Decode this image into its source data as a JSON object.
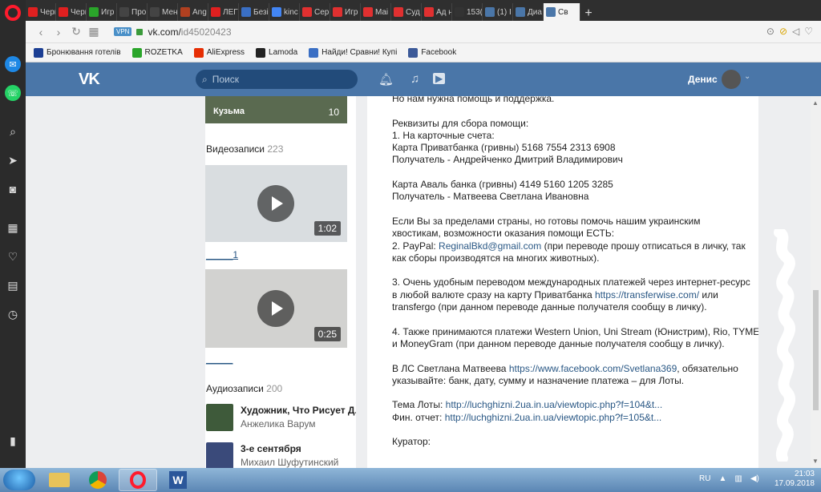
{
  "browser": {
    "tabs": [
      {
        "label": "Черг",
        "color": "#e02020"
      },
      {
        "label": "Черг",
        "color": "#e02020"
      },
      {
        "label": "Игр",
        "color": "#2aa52a"
      },
      {
        "label": "Про",
        "color": "#444444"
      },
      {
        "label": "Мен",
        "color": "#444444"
      },
      {
        "label": "Ang",
        "color": "#b04020"
      },
      {
        "label": "ЛЕГ",
        "color": "#e02020"
      },
      {
        "label": "Безі",
        "color": "#3a6fc4"
      },
      {
        "label": "kinc",
        "color": "#4285f4"
      },
      {
        "label": "Сер",
        "color": "#e03030"
      },
      {
        "label": "Игр",
        "color": "#e03030"
      },
      {
        "label": "Mai",
        "color": "#e03030"
      },
      {
        "label": "Суд",
        "color": "#e03030"
      },
      {
        "label": "Ад н",
        "color": "#e03030"
      },
      {
        "label": "153(",
        "color": "#333333"
      },
      {
        "label": "(1) I",
        "color": "#4a76a8"
      },
      {
        "label": "Диа",
        "color": "#4a76a8"
      },
      {
        "label": "Св",
        "color": "#4a76a8"
      }
    ],
    "url_host": "vk.com/",
    "url_path": "id45020423",
    "vpn_label": "VPN",
    "bookmarks": [
      {
        "label": "Бронювання готелів",
        "color": "#1c3f94"
      },
      {
        "label": "ROZETKA",
        "color": "#2aa52a"
      },
      {
        "label": "AliExpress",
        "color": "#e62e04"
      },
      {
        "label": "Lamoda",
        "color": "#222222"
      },
      {
        "label": "Найди! Сравни! Купі",
        "color": "#3a6fc4"
      },
      {
        "label": "Facebook",
        "color": "#3b5998"
      }
    ]
  },
  "vk": {
    "search_placeholder": "Поиск",
    "user_name": "Денис",
    "photo_album_label": "Кузьма",
    "photo_album_count": "10",
    "videos_title": "Видеозаписи",
    "videos_count": "223",
    "videos": [
      {
        "duration": "1:02",
        "title": "_____1"
      },
      {
        "duration": "0:25",
        "title": "_____"
      }
    ],
    "audio_title": "Аудиозаписи",
    "audio_count": "200",
    "audios": [
      {
        "title": "Художник, Что Рисует Д...",
        "artist": "Анжелика Варум"
      },
      {
        "title": "3-е сентября",
        "artist": "Михаил Шуфутинский"
      }
    ],
    "post_lines": [
      {
        "t": "Но нам нужна помощь и поддержка."
      },
      {
        "t": ""
      },
      {
        "t": "Реквизиты для сбора помощи:"
      },
      {
        "t": "1. На карточные счета:"
      },
      {
        "t": "Карта Приватбанка (гривны) 5168 7554 2313 6908"
      },
      {
        "t": "Получатель - Андрейченко Дмитрий Владимирович"
      },
      {
        "t": ""
      },
      {
        "t": "Карта Аваль банка (гривны) 4149 5160 1205 3285"
      },
      {
        "t": "Получатель - Матвеева Светлана Ивановна"
      },
      {
        "t": ""
      },
      {
        "t": "Если Вы за пределами страны, но готовы помочь нашим украинским"
      },
      {
        "t": "хвостикам, возможности оказания помощи ЕСТЬ:"
      },
      {
        "t": "2. PayPal: ",
        "link": "ReginalBkd@gmail.com",
        "after": " (при переводе прошу отписаться в личку, так"
      },
      {
        "t": "как сборы производятся на многих животных)."
      },
      {
        "t": ""
      },
      {
        "t": "3. Очень удобным переводом международных платежей через интернет-ресурс"
      },
      {
        "t": "в любой валюте сразу на карту Приватбанка ",
        "link": "https://transferwise.com/",
        "after": " или"
      },
      {
        "t": "transfergo (при данном переводе данные получателя сообщу в личку)."
      },
      {
        "t": ""
      },
      {
        "t": "4. Также принимаются платежи Western Union, Uni Stream (Юнистрим), Rio, TYME"
      },
      {
        "t": "и MoneyGram (при данном переводе данные получателя сообщу в личку)."
      },
      {
        "t": ""
      },
      {
        "t": "В ЛС Светлана Матвеева ",
        "link": "https://www.facebook.com/Svetlana369",
        "after": ", обязательно"
      },
      {
        "t": "указывайте: банк, дату, сумму и назначение платежа – для Лоты."
      },
      {
        "t": ""
      },
      {
        "t": "Тема Лоты: ",
        "link": "http://luchghizni.2ua.in.ua/viewtopic.php?f=104&t..."
      },
      {
        "t": "Фин. отчет: ",
        "link": "http://luchghizni.2ua.in.ua/viewtopic.php?f=105&t..."
      },
      {
        "t": ""
      },
      {
        "t": "Куратор:"
      }
    ]
  },
  "taskbar": {
    "lang": "RU",
    "time": "21:03",
    "date": "17.09.2018"
  },
  "colors": {
    "vk_header": "#4a76a8",
    "link": "#2a5885",
    "opera_red": "#ff1b2d"
  }
}
